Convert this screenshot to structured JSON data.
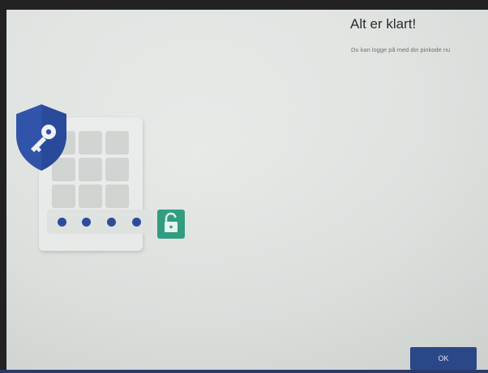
{
  "dialog": {
    "title": "Alt er klart!",
    "subtitle": "Du kan logge på med din pinkode nu"
  },
  "actions": {
    "ok_label": "OK"
  },
  "illustration": {
    "shield_icon": "shield-key-icon",
    "lock_icon": "unlocked-padlock-icon",
    "pin_dots_filled": 4,
    "keypad_cells": 9
  },
  "colors": {
    "accent": "#2b4a8c",
    "shield": "#2a4fa8",
    "lock_badge": "#2e9e80",
    "background": "#e3e6e4"
  }
}
